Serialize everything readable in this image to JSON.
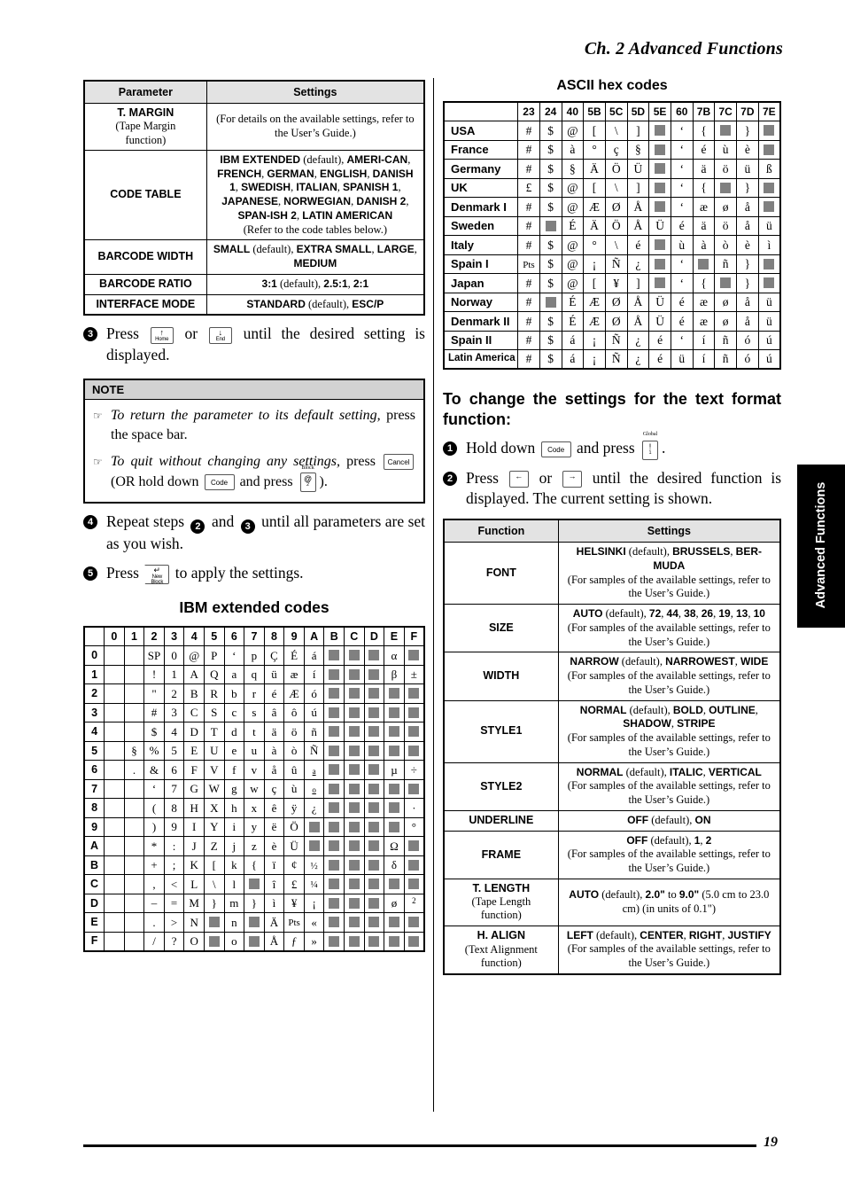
{
  "header": {
    "chapter": "Ch. 2 Advanced Functions"
  },
  "side_tab": {
    "label": "Advanced Functions"
  },
  "footer": {
    "page_number": "19"
  },
  "left_column": {
    "settings_table": {
      "headers": [
        "Parameter",
        "Settings"
      ],
      "rows": [
        {
          "param": "T. MARGIN",
          "param_sub": "(Tape Margin function)",
          "settings_html": "(For details on the available settings, refer to the User’s Guide.)"
        },
        {
          "param": "CODE TABLE",
          "param_sub": "",
          "settings_html": "<b>IBM EXTENDED</b> (default), <b>AMERI-CAN</b>, <b>FRENCH</b>, <b>GERMAN</b>, <b>ENGLISH</b>, <b>DANISH 1</b>, <b>SWEDISH</b>, <b>ITALIAN</b>, <b>SPANISH 1</b>, <b>JAPANESE</b>, <b>NORWEGIAN</b>, <b>DANISH 2</b>, <b>SPAN-ISH 2</b>, <b>LATIN AMERICAN</b><br>(Refer to the code tables below.)"
        },
        {
          "param": "BARCODE WIDTH",
          "param_sub": "",
          "settings_html": "<b>SMALL</b> (default), <b>EXTRA SMALL</b>, <b>LARGE</b>, <b>MEDIUM</b>"
        },
        {
          "param": "BARCODE RATIO",
          "param_sub": "",
          "settings_html": "<b>3:1</b> (default), <b>2.5:1</b>, <b>2:1</b>"
        },
        {
          "param": "INTERFACE MODE",
          "param_sub": "",
          "settings_html": "<b>STANDARD</b> (default), <b>ESC/P</b>"
        }
      ]
    },
    "step3": {
      "number": "3",
      "text_a": "Press",
      "key1": {
        "main": "↑",
        "label": "Home"
      },
      "text_b": "or",
      "key2": {
        "main": "↓",
        "label": "End"
      },
      "text_c": "until the desired setting is displayed."
    },
    "note": {
      "title": "NOTE",
      "items": [
        {
          "italic": "To return the parameter to its default setting,",
          "rest": " press the space bar."
        },
        {
          "italic": "To quit without changing any settings,",
          "rest": " press"
        }
      ],
      "item2_keys": {
        "cancel": "Cancel",
        "mid": "(OR hold down",
        "code": "Code",
        "mid2": "and press",
        "key_top": "Block",
        "key_main": "@",
        "key_sub": "2",
        "tail": ")."
      }
    },
    "step4": {
      "number": "4",
      "text_a": "Repeat steps",
      "ref1": "2",
      "text_b": "and",
      "ref2": "3",
      "text_c": "until all parameters are set as you wish."
    },
    "step5": {
      "number": "5",
      "text_a": "Press",
      "key": {
        "main": "↵",
        "label": "New Block"
      },
      "text_b": "to apply the settings."
    },
    "ibm_heading": "IBM extended codes",
    "ibm_table": {
      "col_headers": [
        "0",
        "1",
        "2",
        "3",
        "4",
        "5",
        "6",
        "7",
        "8",
        "9",
        "A",
        "B",
        "C",
        "D",
        "E",
        "F"
      ],
      "row_headers": [
        "0",
        "1",
        "2",
        "3",
        "4",
        "5",
        "6",
        "7",
        "8",
        "9",
        "A",
        "B",
        "C",
        "D",
        "E",
        "F"
      ],
      "rows": [
        [
          "",
          "",
          "SP",
          "0",
          "@",
          "P",
          "‘",
          "p",
          "Ç",
          "É",
          "á",
          "■",
          "■",
          "■",
          "α",
          "■"
        ],
        [
          "",
          "",
          "!",
          "1",
          "A",
          "Q",
          "a",
          "q",
          "ü",
          "æ",
          "í",
          "■",
          "■",
          "■",
          "β",
          "±"
        ],
        [
          "",
          "",
          "\"",
          "2",
          "B",
          "R",
          "b",
          "r",
          "é",
          "Æ",
          "ó",
          "■",
          "■",
          "■",
          "■",
          "■"
        ],
        [
          "",
          "",
          "#",
          "3",
          "C",
          "S",
          "c",
          "s",
          "â",
          "ô",
          "ú",
          "■",
          "■",
          "■",
          "■",
          "■"
        ],
        [
          "",
          "",
          "$",
          "4",
          "D",
          "T",
          "d",
          "t",
          "ä",
          "ö",
          "ñ",
          "■",
          "■",
          "■",
          "■",
          "■"
        ],
        [
          "",
          "§",
          "%",
          "5",
          "E",
          "U",
          "e",
          "u",
          "à",
          "ò",
          "Ñ",
          "■",
          "■",
          "■",
          "■",
          "■"
        ],
        [
          "",
          ".",
          "&",
          "6",
          "F",
          "V",
          "f",
          "v",
          "å",
          "û",
          "ª",
          "■",
          "■",
          "■",
          "µ",
          "÷"
        ],
        [
          "",
          "",
          "‘",
          "7",
          "G",
          "W",
          "g",
          "w",
          "ç",
          "ù",
          "º",
          "■",
          "■",
          "■",
          "■",
          "■"
        ],
        [
          "",
          "",
          "(",
          "8",
          "H",
          "X",
          "h",
          "x",
          "ê",
          "ÿ",
          "¿",
          "■",
          "■",
          "■",
          "■",
          "·"
        ],
        [
          "",
          "",
          ")",
          "9",
          "I",
          "Y",
          "i",
          "y",
          "ë",
          "Ö",
          "■",
          "■",
          "■",
          "■",
          "■",
          "°"
        ],
        [
          "",
          "",
          "*",
          ":",
          "J",
          "Z",
          "j",
          "z",
          "è",
          "Ü",
          "■",
          "■",
          "■",
          "■",
          "Ω",
          "■"
        ],
        [
          "",
          "",
          "+",
          ";",
          "K",
          "[",
          "k",
          "{",
          "ï",
          "¢",
          "½",
          "■",
          "■",
          "■",
          "δ",
          "■"
        ],
        [
          "",
          "",
          ",",
          "<",
          "L",
          "\\",
          "l",
          "■",
          "î",
          "£",
          "¼",
          "■",
          "■",
          "■",
          "■",
          "■"
        ],
        [
          "",
          "",
          "–",
          "=",
          "M",
          "}",
          "m",
          "}",
          "ì",
          "¥",
          "¡",
          "■",
          "■",
          "■",
          "ø",
          "²"
        ],
        [
          "",
          "",
          ".",
          ">",
          "N",
          "■",
          "n",
          "■",
          "Ä",
          "Pts",
          "«",
          "■",
          "■",
          "■",
          "■",
          "■"
        ],
        [
          "",
          "",
          "/",
          "?",
          "O",
          "■",
          "o",
          "■",
          "Å",
          "ƒ",
          "»",
          "■",
          "■",
          "■",
          "■",
          "■"
        ]
      ]
    }
  },
  "right_column": {
    "ascii_title": "ASCII hex codes",
    "ascii_table": {
      "col_headers": [
        "23",
        "24",
        "40",
        "5B",
        "5C",
        "5D",
        "5E",
        "60",
        "7B",
        "7C",
        "7D",
        "7E"
      ],
      "rows": [
        {
          "lang": "USA",
          "cells": [
            "#",
            "$",
            "@",
            "[",
            "\\",
            "]",
            "■",
            "‘",
            "{",
            "■",
            "}",
            "■"
          ]
        },
        {
          "lang": "France",
          "cells": [
            "#",
            "$",
            "à",
            "°",
            "ç",
            "§",
            "■",
            "‘",
            "é",
            "ù",
            "è",
            "■"
          ]
        },
        {
          "lang": "Germany",
          "cells": [
            "#",
            "$",
            "§",
            "Ä",
            "Ö",
            "Ü",
            "■",
            "‘",
            "ä",
            "ö",
            "ü",
            "ß"
          ]
        },
        {
          "lang": "UK",
          "cells": [
            "£",
            "$",
            "@",
            "[",
            "\\",
            "]",
            "■",
            "‘",
            "{",
            "■",
            "}",
            "■"
          ]
        },
        {
          "lang": "Denmark I",
          "cells": [
            "#",
            "$",
            "@",
            "Æ",
            "Ø",
            "Å",
            "■",
            "‘",
            "æ",
            "ø",
            "å",
            "■"
          ]
        },
        {
          "lang": "Sweden",
          "cells": [
            "#",
            "■",
            "É",
            "Ä",
            "Ö",
            "Å",
            "Ü",
            "é",
            "ä",
            "ö",
            "å",
            "ü"
          ]
        },
        {
          "lang": "Italy",
          "cells": [
            "#",
            "$",
            "@",
            "°",
            "\\",
            "é",
            "■",
            "ù",
            "à",
            "ò",
            "è",
            "ì"
          ]
        },
        {
          "lang": "Spain I",
          "cells": [
            "Pts",
            "$",
            "@",
            "¡",
            "Ñ",
            "¿",
            "■",
            "‘",
            "■",
            "ñ",
            "}",
            "■"
          ]
        },
        {
          "lang": "Japan",
          "cells": [
            "#",
            "$",
            "@",
            "[",
            "¥",
            "]",
            "■",
            "‘",
            "{",
            "■",
            "}",
            "■"
          ]
        },
        {
          "lang": "Norway",
          "cells": [
            "#",
            "■",
            "É",
            "Æ",
            "Ø",
            "Å",
            "Ü",
            "é",
            "æ",
            "ø",
            "å",
            "ü"
          ]
        },
        {
          "lang": "Denmark II",
          "cells": [
            "#",
            "$",
            "É",
            "Æ",
            "Ø",
            "Å",
            "Ü",
            "é",
            "æ",
            "ø",
            "å",
            "ü"
          ]
        },
        {
          "lang": "Spain II",
          "cells": [
            "#",
            "$",
            "á",
            "¡",
            "Ñ",
            "¿",
            "é",
            "‘",
            "í",
            "ñ",
            "ó",
            "ú"
          ]
        },
        {
          "lang": "Latin America",
          "cells": [
            "#",
            "$",
            "á",
            "¡",
            "Ñ",
            "¿",
            "é",
            "ü",
            "í",
            "ñ",
            "ó",
            "ú"
          ]
        }
      ]
    },
    "text_format_heading": "To change the settings for the text format function:",
    "step1": {
      "number": "1",
      "text_a": "Hold down",
      "key_code": "Code",
      "text_b": "and press",
      "key_top": "Global",
      "key_main": "!",
      "key_sub": "1",
      "tail": "."
    },
    "step2": {
      "number": "2",
      "text_a": "Press",
      "key1": "←",
      "text_b": "or",
      "key2": "→",
      "text_c": "until the desired function is displayed. The current setting is shown."
    },
    "function_table": {
      "headers": [
        "Function",
        "Settings"
      ],
      "rows": [
        {
          "func": "FONT",
          "func_sub": "",
          "settings_html": "<b>HELSINKI</b> (default), <b>BRUSSELS</b>, <b>BER-MUDA</b><br>(For samples of the available settings, refer to the User’s Guide.)"
        },
        {
          "func": "SIZE",
          "func_sub": "",
          "settings_html": "<b>AUTO</b> (default), <b>72</b>, <b>44</b>, <b>38</b>, <b>26</b>, <b>19</b>, <b>13</b>, <b>10</b><br>(For samples of the available settings, refer to the User’s Guide.)"
        },
        {
          "func": "WIDTH",
          "func_sub": "",
          "settings_html": "<b>NARROW</b> (default), <b>NARROWEST</b>, <b>WIDE</b><br>(For samples of the available settings, refer to the User’s Guide.)"
        },
        {
          "func": "STYLE1",
          "func_sub": "",
          "settings_html": "<b>NORMAL</b> (default), <b>BOLD</b>, <b>OUTLINE</b>, <b>SHADOW</b>, <b>STRIPE</b><br>(For samples of the available settings, refer to the User’s Guide.)"
        },
        {
          "func": "STYLE2",
          "func_sub": "",
          "settings_html": "<b>NORMAL</b> (default), <b>ITALIC</b>, <b>VERTICAL</b><br>(For samples of the available settings, refer to the User’s Guide.)"
        },
        {
          "func": "UNDERLINE",
          "func_sub": "",
          "settings_html": "<b>OFF</b> (default), <b>ON</b>"
        },
        {
          "func": "FRAME",
          "func_sub": "",
          "settings_html": "<b>OFF</b> (default), <b>1</b>, <b>2</b><br>(For samples of the available settings, refer to the User’s Guide.)"
        },
        {
          "func": "T. LENGTH",
          "func_sub": "(Tape Length function)",
          "settings_html": "<b>AUTO</b> (default), <b>2.0\"</b> to <b>9.0\"</b> (5.0 cm to 23.0 cm) (in units of 0.1\")"
        },
        {
          "func": "H. ALIGN",
          "func_sub": "(Text Alignment function)",
          "settings_html": "<b>LEFT</b> (default), <b>CENTER</b>, <b>RIGHT</b>, <b>JUSTIFY</b><br>(For samples of the available settings, refer to the User’s Guide.)"
        }
      ]
    }
  }
}
